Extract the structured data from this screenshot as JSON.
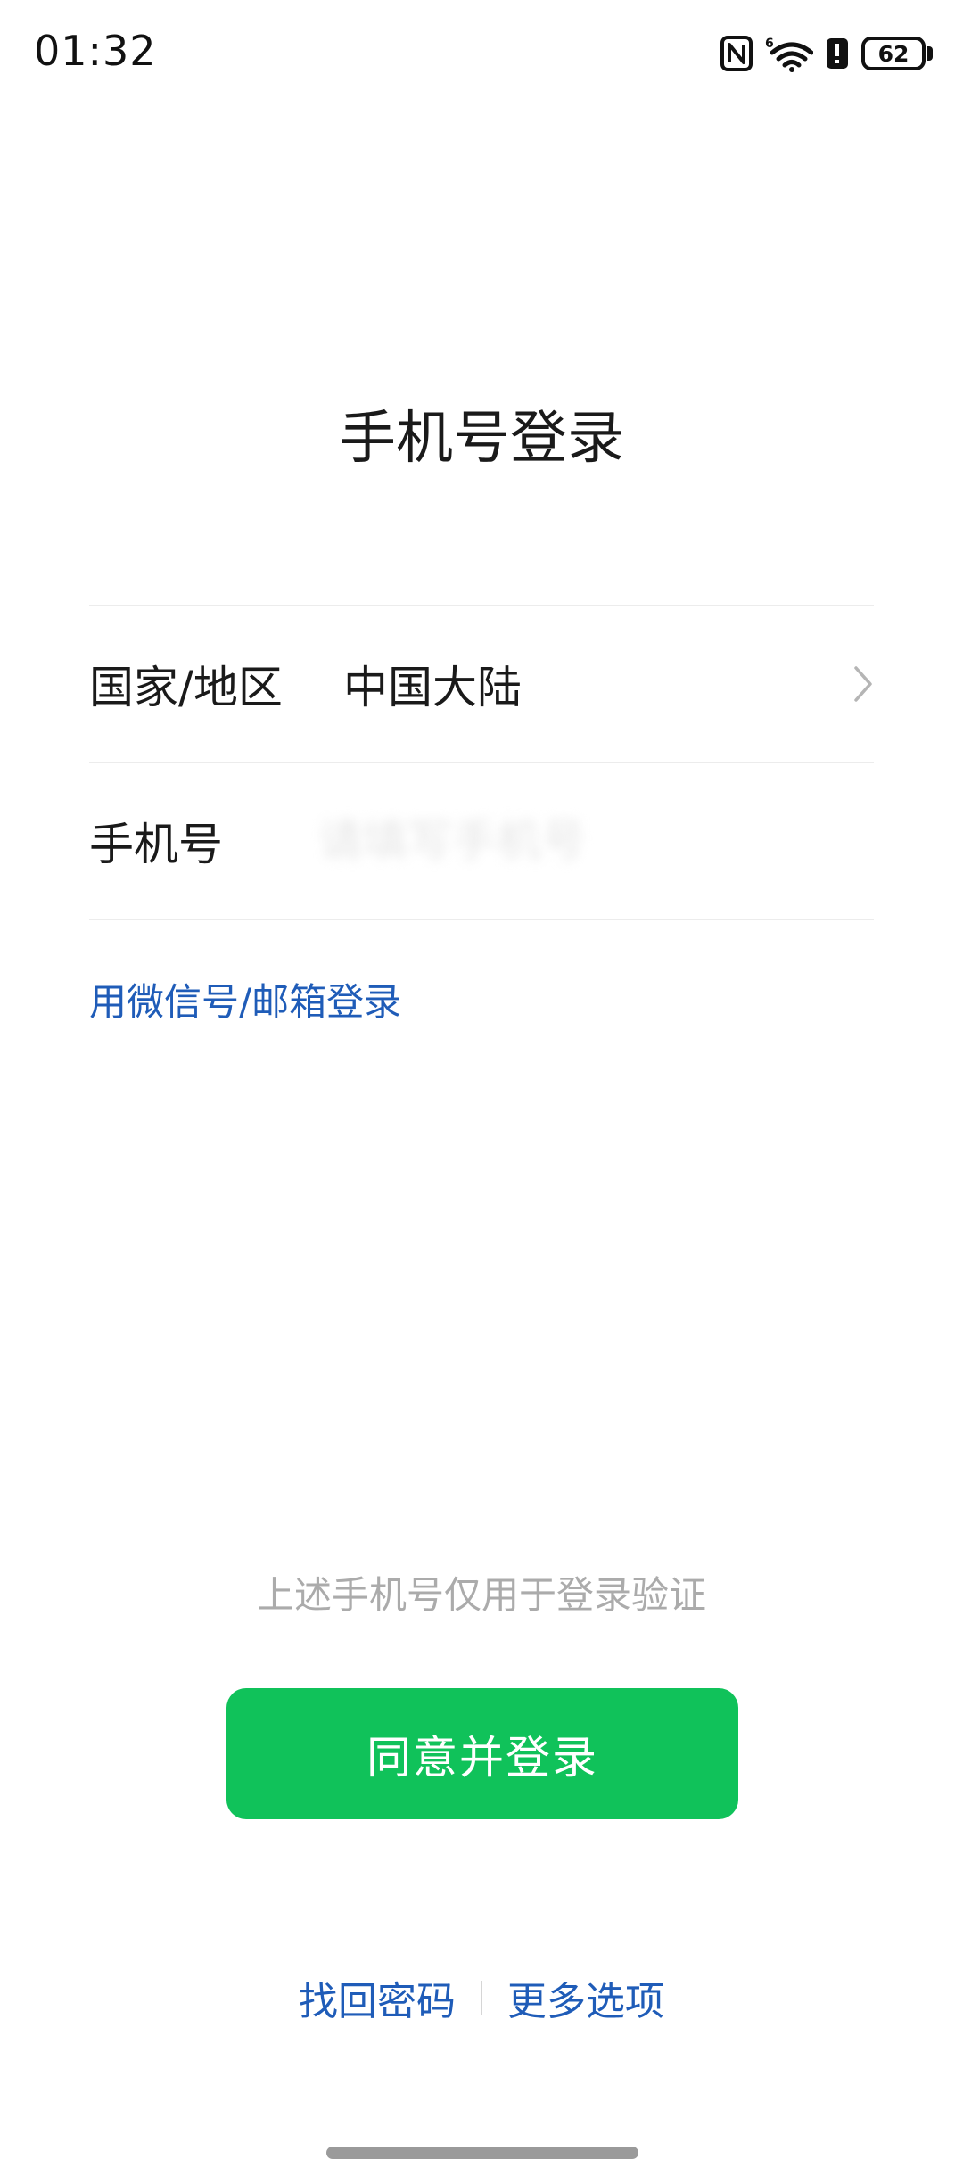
{
  "status_bar": {
    "time": "01:32",
    "battery_level": "62",
    "icons": [
      "nfc-icon",
      "wifi-6-icon",
      "alert-icon",
      "battery-icon"
    ]
  },
  "page": {
    "title": "手机号登录"
  },
  "form": {
    "region_label": "国家/地区",
    "region_value": "中国大陆",
    "phone_label": "手机号",
    "phone_placeholder": "请填写手机号"
  },
  "alt_login": {
    "label": "用微信号/邮箱登录"
  },
  "hint": {
    "text": "上述手机号仅用于登录验证"
  },
  "actions": {
    "agree_login_label": "同意并登录"
  },
  "bottom_links": {
    "recover_password": "找回密码",
    "more_options": "更多选项"
  },
  "colors": {
    "primary_green": "#10c25a",
    "link_blue": "#1f5cb8",
    "hint_gray": "#ababab"
  }
}
